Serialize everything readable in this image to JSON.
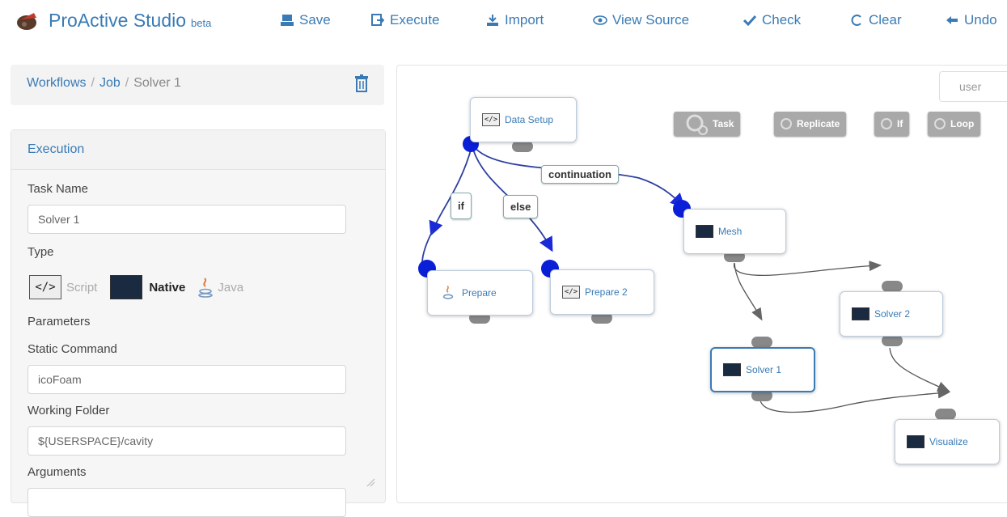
{
  "app": {
    "name": "ProActive Studio",
    "badge": "beta"
  },
  "toolbar": {
    "save": "Save",
    "execute": "Execute",
    "import": "Import",
    "view_source": "View Source",
    "check": "Check",
    "clear": "Clear",
    "undo": "Undo"
  },
  "breadcrumb": {
    "workflows": "Workflows",
    "job": "Job",
    "task": "Solver 1",
    "separator": "/"
  },
  "panel": {
    "title": "Execution",
    "task_name_label": "Task Name",
    "task_name_value": "Solver 1",
    "type_label": "Type",
    "types": {
      "script": "Script",
      "native": "Native",
      "java": "Java"
    },
    "parameters_label": "Parameters",
    "static_command_label": "Static Command",
    "static_command_value": "icoFoam",
    "working_folder_label": "Working Folder",
    "working_folder_value": "${USERSPACE}/cavity",
    "arguments_label": "Arguments"
  },
  "canvas": {
    "user_label": "user",
    "palette": {
      "task": "Task",
      "replicate": "Replicate",
      "if": "If",
      "loop": "Loop"
    },
    "nodes": {
      "data_setup": "Data Setup",
      "mesh": "Mesh",
      "prepare": "Prepare",
      "prepare2": "Prepare 2",
      "solver1": "Solver 1",
      "solver2": "Solver 2",
      "visualize": "Visualize"
    },
    "edges": {
      "continuation": "continuation",
      "if": "if",
      "else": "else"
    }
  },
  "colors": {
    "accent": "#3a7bb5",
    "endpoint": "#0a1fd8",
    "link": "#2d3fa0"
  }
}
